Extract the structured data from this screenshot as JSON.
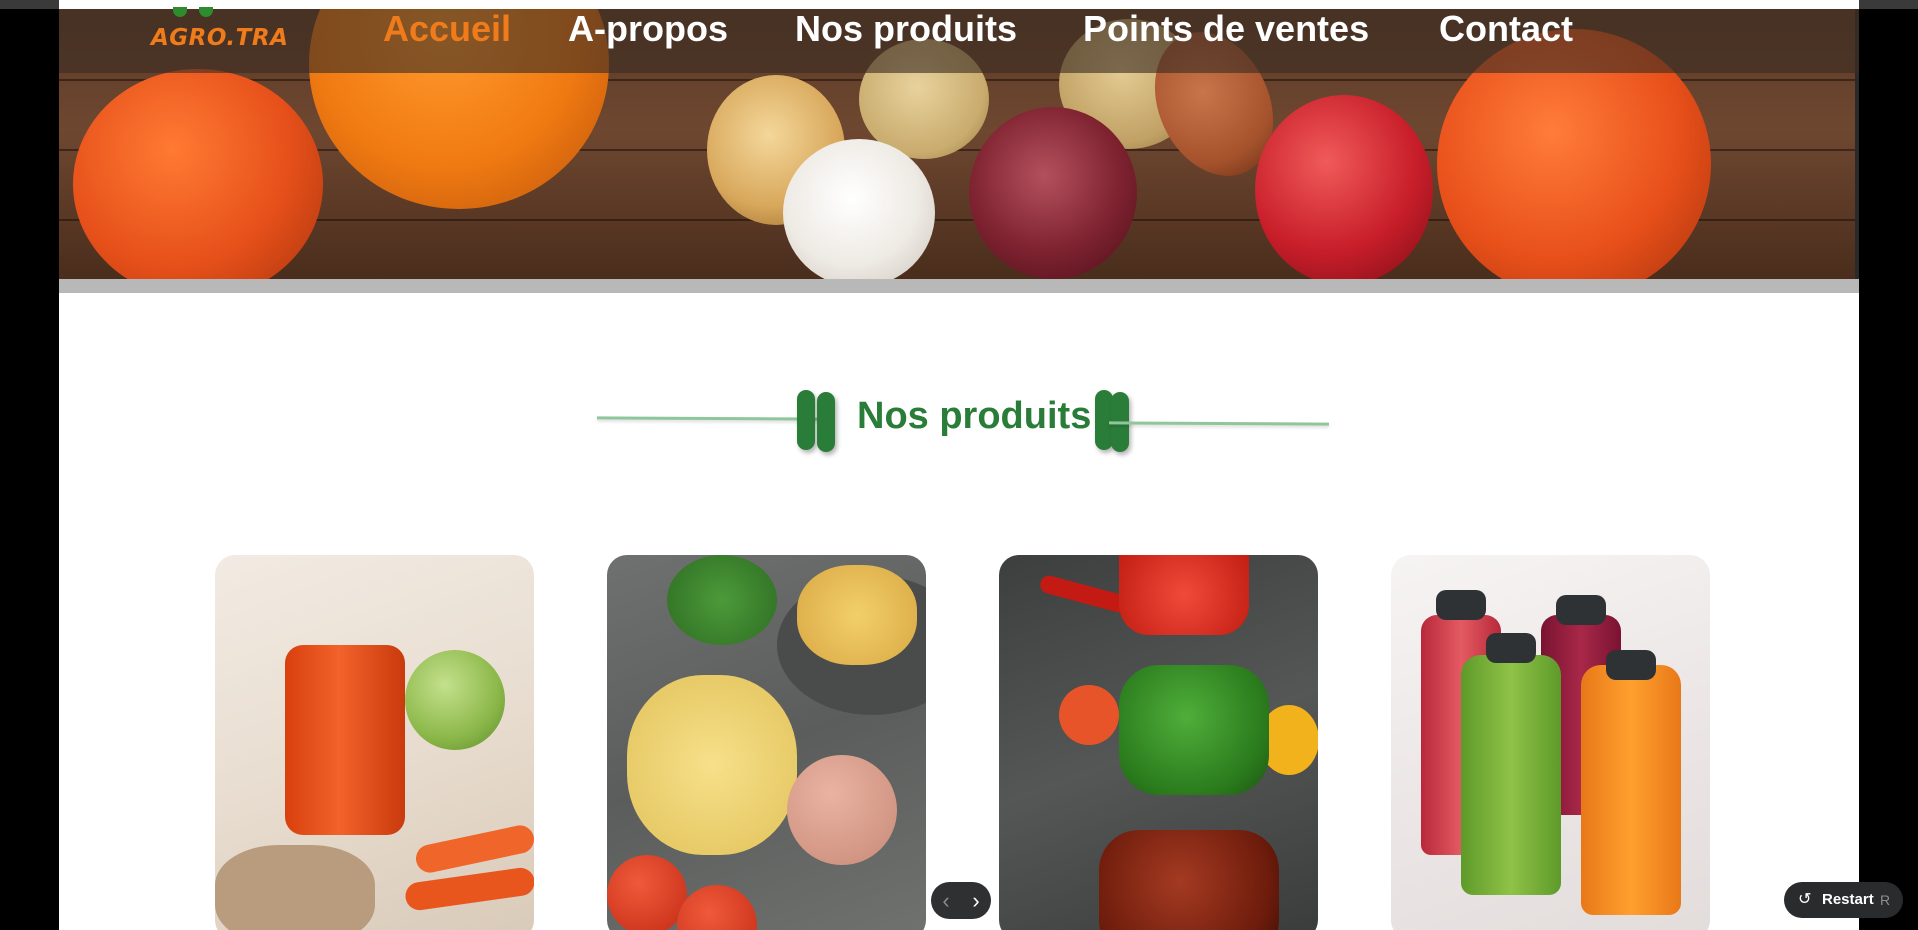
{
  "header": {
    "logo_text": "AGRO.TRA",
    "nav": [
      {
        "label": "Accueil",
        "active": true
      },
      {
        "label": "A-propos",
        "active": false
      },
      {
        "label": "Nos produits",
        "active": false
      },
      {
        "label": "Points de ventes",
        "active": false
      },
      {
        "label": "Contact",
        "active": false
      }
    ]
  },
  "section": {
    "title": "Nos produits"
  },
  "products": [
    {
      "image": "juice-carrot-apple"
    },
    {
      "image": "chips-potatoes-tomatoes"
    },
    {
      "image": "sauces-in-jars"
    },
    {
      "image": "juice-bottles"
    }
  ],
  "carousel": {
    "prev_icon": "chevron-left-icon",
    "next_icon": "chevron-right-icon"
  },
  "restart": {
    "label": "Restart",
    "shortcut": "R",
    "icon": "restart-icon"
  },
  "colors": {
    "accent_orange": "#f07b1a",
    "brand_green": "#2a7d38"
  }
}
